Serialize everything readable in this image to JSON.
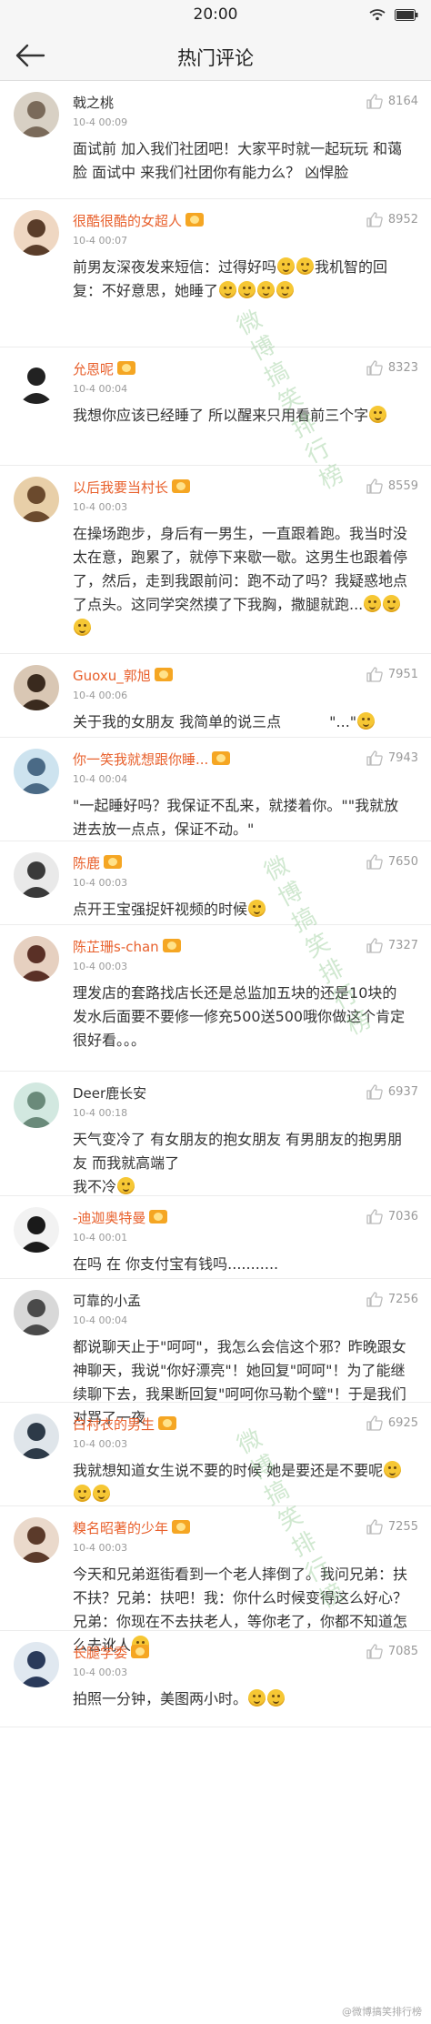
{
  "status": {
    "time": "20:00"
  },
  "nav": {
    "title": "热门评论"
  },
  "comments": [
    {
      "user": "戟之桃",
      "time": "10-4 00:09",
      "likes": "8164",
      "vip": false,
      "badge": false,
      "segments": [
        "面试前 加入我们社团吧！大家平时就一起玩玩 和蔼脸 面试中 来我们社团你有能力么？ 凶悍脸"
      ],
      "emojis": []
    },
    {
      "user": "很酷很酷的女超人",
      "time": "10-4 00:07",
      "likes": "8952",
      "vip": true,
      "badge": true,
      "segments": [
        "前男友深夜发来短信：过得好吗",
        "",
        "",
        "我机智的回复：不好意思，她睡了",
        "",
        "",
        "",
        ""
      ],
      "emojis": []
    },
    {
      "user": "允恩呢",
      "time": "10-4 00:04",
      "likes": "8323",
      "vip": true,
      "badge": true,
      "segments": [
        "我想你应该已经睡了 所以醒来只用看前三个字",
        ""
      ],
      "emojis": []
    },
    {
      "user": "以后我要当村长",
      "time": "10-4 00:03",
      "likes": "8559",
      "vip": true,
      "badge": true,
      "segments": [
        "在操场跑步，身后有一男生，一直跟着跑。我当时没太在意，跑累了，就停下来歇一歇。这男生也跟着停了，然后，走到我跟前问：跑不动了吗？我疑惑地点了点头。这同学突然摸了下我胸，撒腿就跑...",
        "",
        "",
        ""
      ],
      "emojis": []
    },
    {
      "user": "Guoxu_郭旭",
      "time": "10-4 00:06",
      "likes": "7951",
      "vip": true,
      "badge": true,
      "segments": [
        "关于我的女朋友 我简单的说三点 　　　\"...\"",
        ""
      ],
      "emojis": []
    },
    {
      "user": "你一笑我就想跟你睡...",
      "time": "10-4 00:04",
      "likes": "7943",
      "vip": true,
      "badge": true,
      "segments": [
        "\"一起睡好吗？我保证不乱来，就搂着你。\"\"我就放进去放一点点，保证不动。\""
      ],
      "emojis": []
    },
    {
      "user": "陈鹿",
      "time": "10-4 00:03",
      "likes": "7650",
      "vip": true,
      "badge": true,
      "segments": [
        "点开王宝强捉奸视频的时候",
        ""
      ],
      "emojis": []
    },
    {
      "user": "陈芷珊s-chan",
      "time": "10-4 00:03",
      "likes": "7327",
      "vip": true,
      "badge": true,
      "segments": [
        "理发店的套路",
        "找店长还是总监",
        "加五块的还是10块的发水",
        "后面要不要修一修",
        "充500送500哦",
        "你做这个肯定很好看。。。"
      ],
      "emojis": []
    },
    {
      "user": "Deer鹿长安",
      "time": "10-4 00:18",
      "likes": "6937",
      "vip": false,
      "badge": false,
      "segments": [
        "天气变冷了 有女朋友的抱女朋友 有男朋友的抱男朋友 而我就高端了\n我不冷",
        ""
      ],
      "emojis": []
    },
    {
      "user": "-迪迦奥特曼",
      "time": "10-4 00:01",
      "likes": "7036",
      "vip": true,
      "badge": true,
      "segments": [
        "在吗 在 你支付宝有钱吗..........."
      ],
      "emojis": []
    },
    {
      "user": "可靠的小孟",
      "time": "10-4 00:04",
      "likes": "7256",
      "vip": false,
      "badge": false,
      "segments": [
        "都说聊天止于\"呵呵\"，我怎么会信这个邪？昨晚跟女神聊天，我说\"你好漂亮\"！她回复\"呵呵\"！为了能继续聊下去，我果断回复\"呵呵你马勒个璧\"！于是我们对骂了一夜"
      ],
      "emojis": []
    },
    {
      "user": "白衬衣的男生",
      "time": "10-4 00:03",
      "likes": "6925",
      "vip": true,
      "badge": true,
      "segments": [
        "我就想知道女生说不要的时候 她是要还是不要呢",
        "",
        "",
        ""
      ],
      "emojis": []
    },
    {
      "user": "糗名昭著的少年",
      "time": "10-4 00:03",
      "likes": "7255",
      "vip": true,
      "badge": true,
      "segments": [
        "今天和兄弟逛街看到一个老人摔倒了。我问兄弟：扶不扶？兄弟：扶吧！我：你什么时候变得这么好心？兄弟：你现在不去扶老人，等你老了，你都不知道怎么去讹人",
        ""
      ],
      "emojis": []
    },
    {
      "user": "长腿学委",
      "time": "10-4 00:03",
      "likes": "7085",
      "vip": true,
      "badge": true,
      "segments": [
        "拍照一分钟，美图两小时。",
        "",
        ""
      ],
      "emojis": []
    }
  ],
  "watermark": {
    "text": "微博搞笑排行榜"
  },
  "footer": {
    "mark": "@微博搞笑排行榜"
  },
  "colors": {
    "vip_name": "#e8602c",
    "like_icon": "#bbbbbb",
    "bar_bg": "#f6f6f6"
  }
}
